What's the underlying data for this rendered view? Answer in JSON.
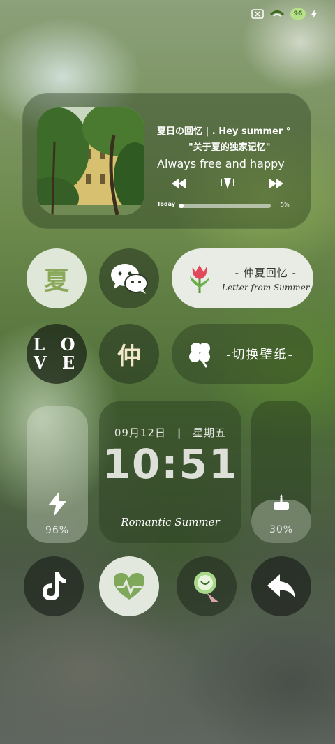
{
  "status": {
    "battery": "96"
  },
  "music": {
    "title": "夏日の回忆 | . Hey summer °",
    "subtitle": "\"关于夏的独家记忆\"",
    "line": "Always free and happy",
    "today_label": "Today",
    "progress": 0.05,
    "progress_label": "5%"
  },
  "tiles": {
    "xia": "夏",
    "wechat_icon": "wechat-icon",
    "letter_title": "- 仲夏回忆 -",
    "letter_sub": "Letter from Summer",
    "love_top": "L O",
    "love_bottom": "V E",
    "zhong": "仲",
    "wallpaper_label": "-切换壁纸-"
  },
  "widgets": {
    "battery_pct": "96%",
    "date": "09月12日",
    "weekday": "星期五",
    "time": "10:51",
    "tagline": "Romantic Summer",
    "storage_pct": "30%"
  },
  "dock": [
    "tiktok-icon",
    "health-icon",
    "app-icon",
    "back-icon"
  ],
  "colors": {
    "accent": "#8aa85a",
    "health": "#7fa85a"
  }
}
